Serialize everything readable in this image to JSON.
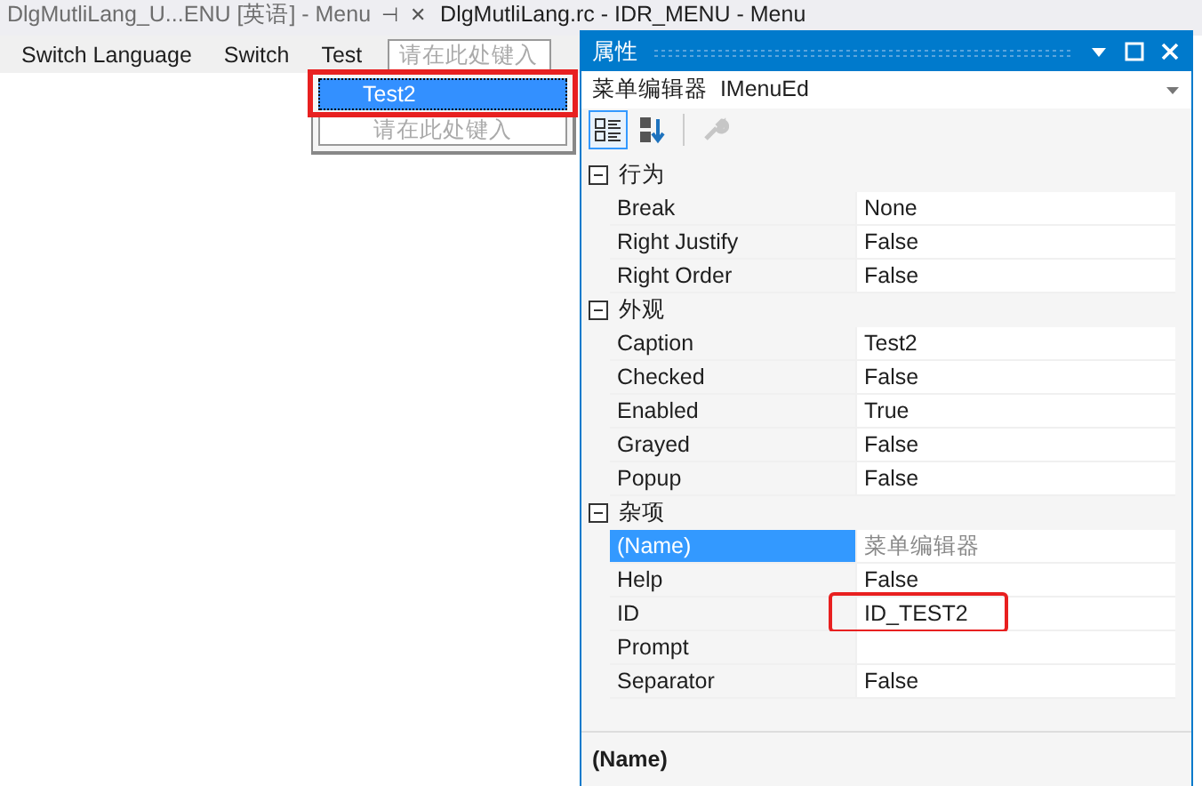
{
  "doc_tabs": [
    {
      "label": "DlgMutliLang_U...ENU [英语] - Menu",
      "selected": false,
      "pin": "⊣",
      "close": "✕"
    },
    {
      "label": "DlgMutliLang.rc - IDR_MENU - Menu",
      "selected": true
    }
  ],
  "menu_bar": {
    "items": [
      "Switch Language",
      "Switch",
      "Test"
    ],
    "placeholder": "请在此处键入"
  },
  "dropdown": {
    "items": [
      {
        "label": "Test2",
        "selected": true,
        "highlighted": true
      }
    ],
    "placeholder": "请在此处键入"
  },
  "properties": {
    "title": "属性",
    "object": "菜单编辑器  IMenuEd",
    "toolbar": [
      {
        "kind": "categorized",
        "selected": true,
        "disabled": false
      },
      {
        "kind": "alphabetical",
        "selected": false,
        "disabled": false
      },
      {
        "kind": "pages",
        "selected": false,
        "disabled": true
      }
    ],
    "categories": [
      {
        "name": "行为",
        "expanded": true,
        "rows": [
          {
            "name": "Break",
            "value": "None",
            "selected": false,
            "readonly": false,
            "highlighted": false
          },
          {
            "name": "Right Justify",
            "value": "False",
            "selected": false,
            "readonly": false,
            "highlighted": false
          },
          {
            "name": "Right Order",
            "value": "False",
            "selected": false,
            "readonly": false,
            "highlighted": false
          }
        ]
      },
      {
        "name": "外观",
        "expanded": true,
        "rows": [
          {
            "name": "Caption",
            "value": "Test2",
            "selected": false,
            "readonly": false,
            "highlighted": false
          },
          {
            "name": "Checked",
            "value": "False",
            "selected": false,
            "readonly": false,
            "highlighted": false
          },
          {
            "name": "Enabled",
            "value": "True",
            "selected": false,
            "readonly": false,
            "highlighted": false
          },
          {
            "name": "Grayed",
            "value": "False",
            "selected": false,
            "readonly": false,
            "highlighted": false
          },
          {
            "name": "Popup",
            "value": "False",
            "selected": false,
            "readonly": false,
            "highlighted": false
          }
        ]
      },
      {
        "name": "杂项",
        "expanded": true,
        "rows": [
          {
            "name": "(Name)",
            "value": "菜单编辑器",
            "selected": true,
            "readonly": true,
            "highlighted": false
          },
          {
            "name": "Help",
            "value": "False",
            "selected": false,
            "readonly": false,
            "highlighted": false
          },
          {
            "name": "ID",
            "value": "ID_TEST2",
            "selected": false,
            "readonly": false,
            "highlighted": true
          },
          {
            "name": "Prompt",
            "selected": false,
            "highlighted": false
          },
          {
            "name": "Separator",
            "value": "False",
            "selected": false,
            "readonly": false,
            "highlighted": false
          }
        ]
      }
    ],
    "description": {
      "title": "(Name)"
    }
  }
}
